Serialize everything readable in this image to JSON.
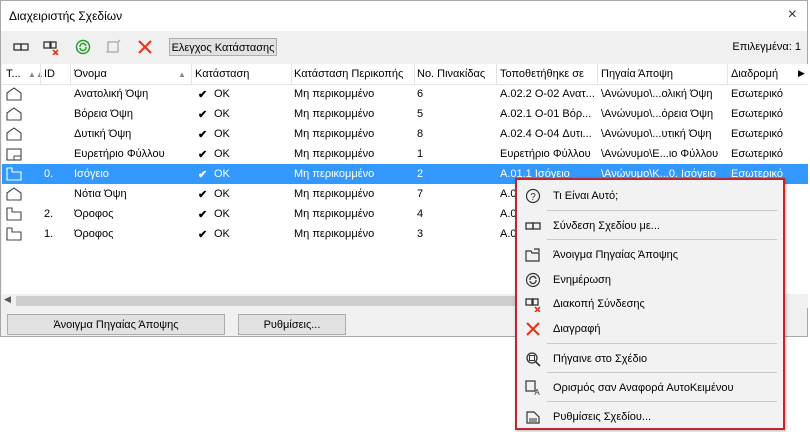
{
  "window": {
    "title": "Διαχειριστής Σχεδίων",
    "close": "×"
  },
  "toolbar": {
    "status_button": "Ελεγχος Κατάστασης",
    "selected_count": "Επιλεγμένα: 1",
    "icons": [
      "link-icon",
      "unlink-icon",
      "update-icon",
      "stop-icon",
      "delete-icon"
    ]
  },
  "table": {
    "headers": [
      "Τ...",
      "ID",
      "Όνομα",
      "Κατάσταση",
      "Κατάσταση Περικοπής",
      "Νο. Πινακίδας",
      "Τοποθετήθηκε σε",
      "Πηγαία Άποψη",
      "Διαδρομή"
    ],
    "rows": [
      {
        "icon": "elevation",
        "id": "",
        "name": "Ανατολική Όψη",
        "status": "OK",
        "crop": "Μη περικομμένο",
        "no": "6",
        "placed": "A.02.2 O-02 Ανατ...",
        "source": "\\Ανώνυμο\\...ολική Όψη",
        "path": "Εσωτερικό"
      },
      {
        "icon": "elevation",
        "id": "",
        "name": "Βόρεια Όψη",
        "status": "OK",
        "crop": "Μη περικομμένο",
        "no": "5",
        "placed": "A.02.1 O-01 Βόρ...",
        "source": "\\Ανώνυμο\\...όρεια Όψη",
        "path": "Εσωτερικό"
      },
      {
        "icon": "elevation",
        "id": "",
        "name": "Δυτική Όψη",
        "status": "OK",
        "crop": "Μη περικομμένο",
        "no": "8",
        "placed": "A.02.4 O-04 Δυτι...",
        "source": "\\Ανώνυμο\\...υτική Όψη",
        "path": "Εσωτερικό"
      },
      {
        "icon": "index",
        "id": "",
        "name": "Ευρετήριο Φύλλου",
        "status": "OK",
        "crop": "Μη περικομμένο",
        "no": "1",
        "placed": "Ευρετήριο Φύλλου",
        "source": "\\Ανώνυμο\\Ε...ιο Φύλλου",
        "path": "Εσωτερικό"
      },
      {
        "icon": "plan",
        "id": "0.",
        "name": "Ισόγειο",
        "status": "OK",
        "crop": "Μη περικομμένο",
        "no": "2",
        "placed": "A.01.1 Ισόγειο",
        "source": "\\Ανώνυμο\\Κ...0. Ισόγειο",
        "path": "Εσωτερικό",
        "selected": true
      },
      {
        "icon": "elevation",
        "id": "",
        "name": "Νότια Όψη",
        "status": "OK",
        "crop": "Μη περικομμένο",
        "no": "7",
        "placed": "A.0",
        "source": "",
        "path": ""
      },
      {
        "icon": "plan",
        "id": "2.",
        "name": "Όροφος",
        "status": "OK",
        "crop": "Μη περικομμένο",
        "no": "4",
        "placed": "A.0",
        "source": "",
        "path": ""
      },
      {
        "icon": "plan",
        "id": "1.",
        "name": "Όροφος",
        "status": "OK",
        "crop": "Μη περικομμένο",
        "no": "3",
        "placed": "A.0",
        "source": "",
        "path": ""
      }
    ]
  },
  "buttons": {
    "open_source": "Άνοιγμα Πηγαίας Άποψης",
    "settings": "Ρυθμίσεις..."
  },
  "context_menu": {
    "items": [
      {
        "label": "Τι Είναι Αυτό;",
        "icon": "help-icon"
      },
      {
        "label": "Σύνδεση Σχεδίου με...",
        "icon": "link-icon"
      },
      {
        "label": "Άνοιγμα Πηγαίας Άποψης",
        "icon": "open-folder-icon"
      },
      {
        "label": "Ενημέρωση",
        "icon": "update-icon"
      },
      {
        "label": "Διακοπή Σύνδεσης",
        "icon": "unlink-icon"
      },
      {
        "label": "Διαγραφή",
        "icon": "delete-icon"
      },
      {
        "label": "Πήγαινε στο Σχέδιο",
        "icon": "goto-icon"
      },
      {
        "label": "Ορισμός σαν Αναφορά ΑυτοΚειμένου",
        "icon": "autotext-icon"
      },
      {
        "label": "Ρυθμίσεις Σχεδίου...",
        "icon": "settings-icon"
      }
    ]
  },
  "colors": {
    "selection": "#3399ff",
    "menu_border": "#c0272d",
    "ok_green": "#2a9d2a",
    "delete_red": "#e8351e"
  }
}
